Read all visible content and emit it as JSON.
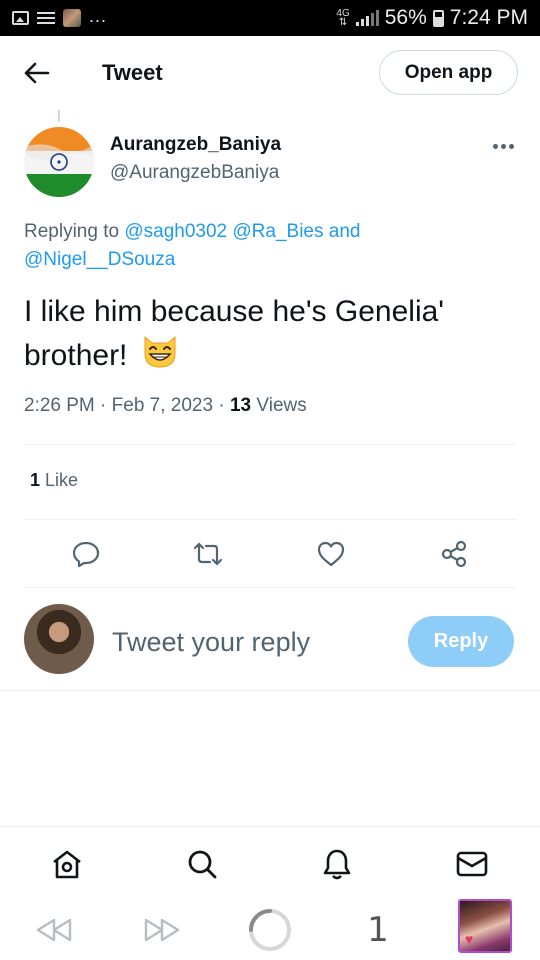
{
  "status_bar": {
    "network": "4G",
    "battery": "56%",
    "time": "7:24 PM",
    "overflow": "..."
  },
  "header": {
    "title": "Tweet",
    "open_app_label": "Open app"
  },
  "tweet": {
    "author_name": "Aurangzeb_Baniya",
    "author_handle": "@AurangzebBaniya",
    "replying_prefix": "Replying to",
    "mention_1": "@sagh0302",
    "mention_2": "@Ra_Bies",
    "mention_joiner": "and",
    "mention_3": "@Nigel__DSouza",
    "text": "I like him because he's Genelia' brother!",
    "emoji": "grinning-cat-with-smiling-eyes",
    "time": "2:26 PM",
    "date": "Feb 7, 2023",
    "views_count": "13",
    "views_label": "Views",
    "likes_count": "1",
    "likes_label": "Like"
  },
  "composer": {
    "placeholder": "Tweet your reply",
    "reply_label": "Reply"
  },
  "bottom_nav": {
    "items": [
      "home-icon",
      "search-icon",
      "notifications-icon",
      "messages-icon"
    ]
  },
  "browser_bar": {
    "tab_count": "1"
  },
  "colors": {
    "accent": "#1d9bf0",
    "reply_button_disabled": "#8ecdf8",
    "secondary_text": "#536471",
    "primary_text": "#0f1419"
  }
}
